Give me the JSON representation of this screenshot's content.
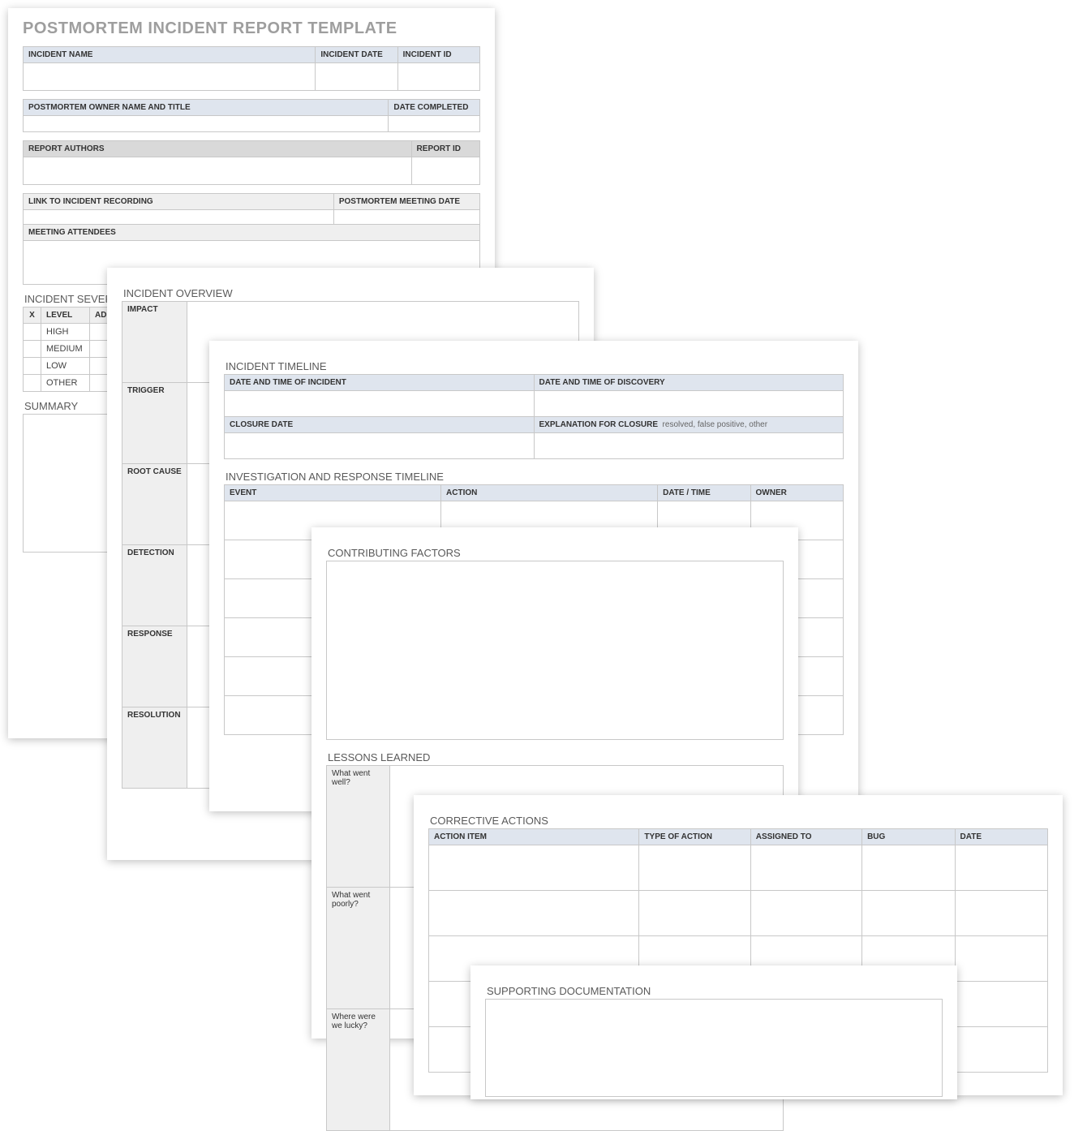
{
  "title": "POSTMORTEM INCIDENT REPORT TEMPLATE",
  "t1": {
    "incident_name": "INCIDENT NAME",
    "incident_date": "INCIDENT DATE",
    "incident_id": "INCIDENT ID",
    "owner": "POSTMORTEM OWNER NAME AND TITLE",
    "date_completed": "DATE COMPLETED",
    "report_authors": "REPORT AUTHORS",
    "report_id": "REPORT ID",
    "link": "LINK TO INCIDENT RECORDING",
    "meeting_date": "POSTMORTEM MEETING DATE",
    "attendees": "MEETING ATTENDEES"
  },
  "severity": {
    "title": "INCIDENT SEVERITY",
    "cols": {
      "x": "X",
      "level": "LEVEL",
      "add": "ADD"
    },
    "rows": [
      "HIGH",
      "MEDIUM",
      "LOW",
      "OTHER"
    ]
  },
  "summary": {
    "title": "SUMMARY"
  },
  "overview": {
    "title": "INCIDENT OVERVIEW",
    "rows": [
      "IMPACT",
      "TRIGGER",
      "ROOT CAUSE",
      "DETECTION",
      "RESPONSE",
      "RESOLUTION"
    ]
  },
  "timeline": {
    "title": "INCIDENT TIMELINE",
    "h": {
      "dti": "DATE AND TIME OF INCIDENT",
      "dtd": "DATE AND TIME OF DISCOVERY",
      "closure": "CLOSURE DATE",
      "closure_exp": "EXPLANATION FOR CLOSURE",
      "closure_hint": "resolved, false positive, other"
    }
  },
  "invest": {
    "title": "INVESTIGATION AND RESPONSE TIMELINE",
    "cols": {
      "event": "EVENT",
      "action": "ACTION",
      "dt": "DATE / TIME",
      "owner": "OWNER"
    }
  },
  "contrib": {
    "title": "CONTRIBUTING FACTORS"
  },
  "lessons": {
    "title": "LESSONS LEARNED",
    "rows": [
      "What went well?",
      "What went poorly?",
      "Where were we lucky?"
    ]
  },
  "corrective": {
    "title": "CORRECTIVE ACTIONS",
    "cols": {
      "item": "ACTION ITEM",
      "type": "TYPE OF ACTION",
      "assigned": "ASSIGNED TO",
      "bug": "BUG",
      "date": "DATE"
    }
  },
  "support": {
    "title": "SUPPORTING DOCUMENTATION"
  }
}
